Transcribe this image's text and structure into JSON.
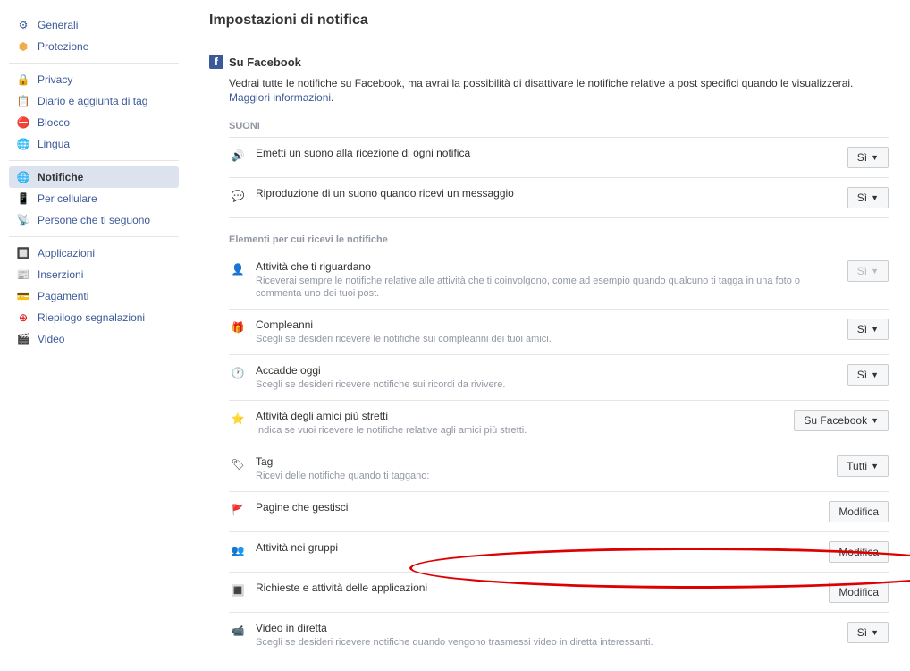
{
  "sidebar": {
    "groups": [
      {
        "items": [
          {
            "label": "Generali",
            "icon": "gear"
          },
          {
            "label": "Protezione",
            "icon": "shield"
          }
        ]
      },
      {
        "items": [
          {
            "label": "Privacy",
            "icon": "lock"
          },
          {
            "label": "Diario e aggiunta di tag",
            "icon": "diary"
          },
          {
            "label": "Blocco",
            "icon": "block"
          },
          {
            "label": "Lingua",
            "icon": "globe"
          }
        ]
      },
      {
        "items": [
          {
            "label": "Notifiche",
            "icon": "globe-blue",
            "active": true
          },
          {
            "label": "Per cellulare",
            "icon": "mobile"
          },
          {
            "label": "Persone che ti seguono",
            "icon": "feed"
          }
        ]
      },
      {
        "items": [
          {
            "label": "Applicazioni",
            "icon": "apps"
          },
          {
            "label": "Inserzioni",
            "icon": "ads"
          },
          {
            "label": "Pagamenti",
            "icon": "card"
          },
          {
            "label": "Riepilogo segnalazioni",
            "icon": "support"
          },
          {
            "label": "Video",
            "icon": "video"
          }
        ]
      }
    ]
  },
  "main": {
    "title": "Impostazioni di notifica",
    "section": {
      "title": "Su Facebook",
      "desc": "Vedrai tutte le notifiche su Facebook, ma avrai la possibilità di disattivare le notifiche relative a post specifici quando le visualizzerai.",
      "link": "Maggiori informazioni"
    },
    "sounds": {
      "title": "SUONI",
      "items": [
        {
          "label": "Emetti un suono alla ricezione di ogni notifica",
          "value": "Sì"
        },
        {
          "label": "Riproduzione di un suono quando ricevi un messaggio",
          "value": "Sì"
        }
      ]
    },
    "elements": {
      "title": "Elementi per cui ricevi le notifiche",
      "items": [
        {
          "label": "Attività che ti riguardano",
          "desc": "Riceverai sempre le notifiche relative alle attività che ti coinvolgono, come ad esempio quando qualcuno ti tagga in una foto o commenta uno dei tuoi post.",
          "value": "Sì",
          "disabled": true,
          "icon": "person"
        },
        {
          "label": "Compleanni",
          "desc": "Scegli se desideri ricevere le notifiche sui compleanni dei tuoi amici.",
          "value": "Sì",
          "icon": "gift"
        },
        {
          "label": "Accadde oggi",
          "desc": "Scegli se desideri ricevere notifiche sui ricordi da rivivere.",
          "value": "Sì",
          "icon": "clock"
        },
        {
          "label": "Attività degli amici più stretti",
          "desc": "Indica se vuoi ricevere le notifiche relative agli amici più stretti.",
          "value": "Su Facebook",
          "icon": "star"
        },
        {
          "label": "Tag",
          "desc": "Ricevi delle notifiche quando ti taggano:",
          "value": "Tutti",
          "icon": "tag"
        },
        {
          "label": "Pagine che gestisci",
          "value": "Modifica",
          "noCaret": true,
          "icon": "flag"
        },
        {
          "label": "Attività nei gruppi",
          "value": "Modifica",
          "noCaret": true,
          "icon": "group"
        },
        {
          "label": "Richieste e attività delle applicazioni",
          "value": "Modifica",
          "noCaret": true,
          "icon": "app"
        },
        {
          "label": "Video in diretta",
          "desc": "Scegli se desideri ricevere notifiche quando vengono trasmessi video in diretta interessanti.",
          "value": "Sì",
          "icon": "live"
        }
      ]
    }
  }
}
